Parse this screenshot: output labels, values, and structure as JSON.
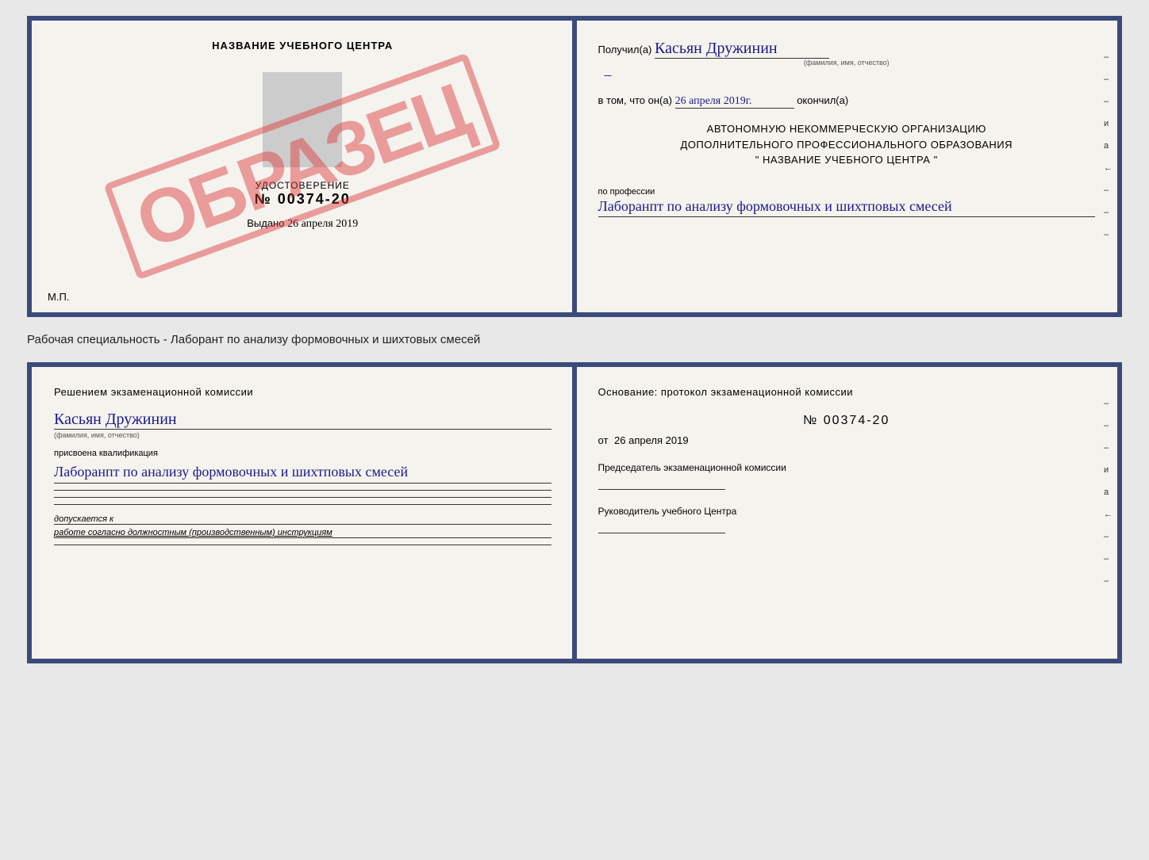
{
  "topCert": {
    "left": {
      "title": "НАЗВАНИЕ УЧЕБНОГО ЦЕНТРА",
      "stampText": "ОБРАЗЕЦ",
      "certLabel": "УДОСТОВЕРЕНИЕ",
      "certNumber": "№ 00374-20",
      "issuedLabel": "Выдано",
      "issuedDate": "26 апреля 2019",
      "mpLabel": "М.П."
    },
    "right": {
      "receivedLabel": "Получил(а)",
      "receivedName": "Касьян Дружинин",
      "fioLabel": "(фамилия, имя, отчество)",
      "dateLabel": "в том, что он(а)",
      "date": "26 апреля 2019г.",
      "okoncilLabel": "окончил(а)",
      "orgLine1": "АВТОНОМНУЮ НЕКОММЕРЧЕСКУЮ ОРГАНИЗАЦИЮ",
      "orgLine2": "ДОПОЛНИТЕЛЬНОГО ПРОФЕССИОНАЛЬНОГО ОБРАЗОВАНИЯ",
      "orgLine3": "\" НАЗВАНИЕ УЧЕБНОГО ЦЕНТРА \"",
      "profLabelPrefix": "по профессии",
      "profession": "Лаборанпт по анализу формовочных и шихтповых смесей"
    },
    "sideMarks": [
      "-",
      "-",
      "-",
      "и",
      "а",
      "←",
      "-",
      "-",
      "-"
    ]
  },
  "subtitle": "Рабочая специальность - Лаборант по анализу формовочных и шихтовых смесей",
  "bottomCert": {
    "left": {
      "decisionTitle": "Решением экзаменационной комиссии",
      "name": "Касьян Дружинин",
      "fioLabel": "(фамилия, имя, отчество)",
      "qualificationLabel": "присвоена квалификация",
      "qualification": "Лаборанпт по анализу формовочных и шихтповых смесей",
      "допускаетсяLabel": "допускается к",
      "допускаетсяText": "работе согласно должностным (производственным) инструкциям"
    },
    "right": {
      "osnovTitle": "Основание: протокол экзаменационной комиссии",
      "protocolNumber": "№ 00374-20",
      "datePrefix": "от",
      "date": "26 апреля 2019",
      "chairmanTitle": "Председатель экзаменационной комиссии",
      "руководительTitle": "Руководитель учебного Центра"
    },
    "sideMarks": [
      "-",
      "-",
      "-",
      "и",
      "а",
      "←",
      "-",
      "-",
      "-"
    ]
  }
}
